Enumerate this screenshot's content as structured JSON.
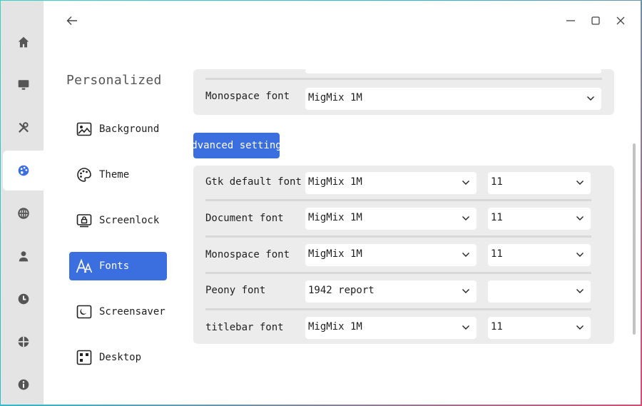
{
  "window": {
    "back_icon": "arrow-left-icon",
    "minimize_icon": "minimize-icon",
    "maximize_icon": "maximize-icon",
    "close_icon": "close-icon"
  },
  "rail": {
    "items": [
      {
        "icon": "home-icon"
      },
      {
        "icon": "monitor-icon"
      },
      {
        "icon": "tools-icon"
      },
      {
        "icon": "palette-icon",
        "active": true
      },
      {
        "icon": "network-icon"
      },
      {
        "icon": "user-icon"
      },
      {
        "icon": "clock-icon"
      },
      {
        "icon": "update-icon"
      },
      {
        "icon": "info-icon"
      }
    ]
  },
  "sidebar": {
    "title": "Personalized",
    "items": [
      {
        "label": "Background",
        "icon": "image-icon"
      },
      {
        "label": "Theme",
        "icon": "palette-icon"
      },
      {
        "label": "Screenlock",
        "icon": "screenlock-icon"
      },
      {
        "label": "Fonts",
        "icon": "font-icon",
        "active": true
      },
      {
        "label": "Screensaver",
        "icon": "screensaver-icon"
      },
      {
        "label": "Desktop",
        "icon": "desktop-grid-icon"
      }
    ]
  },
  "top_card": {
    "monospace_label": "Monospace font",
    "monospace_value": "MigMix 1M"
  },
  "advanced_button": "Advanced settings",
  "advanced": {
    "rows": [
      {
        "label": "Gtk default font",
        "font": "MigMix 1M",
        "size": "11"
      },
      {
        "label": "Document font",
        "font": "MigMix 1M",
        "size": "11"
      },
      {
        "label": "Monospace font",
        "font": "MigMix 1M",
        "size": "11"
      },
      {
        "label": "Peony font",
        "font": "1942 report",
        "size": ""
      },
      {
        "label": "titlebar font",
        "font": "MigMix 1M",
        "size": "11"
      }
    ]
  },
  "colors": {
    "accent": "#3b6fe0",
    "rail_bg": "#e4e4e4",
    "card_bg": "#ececec"
  }
}
